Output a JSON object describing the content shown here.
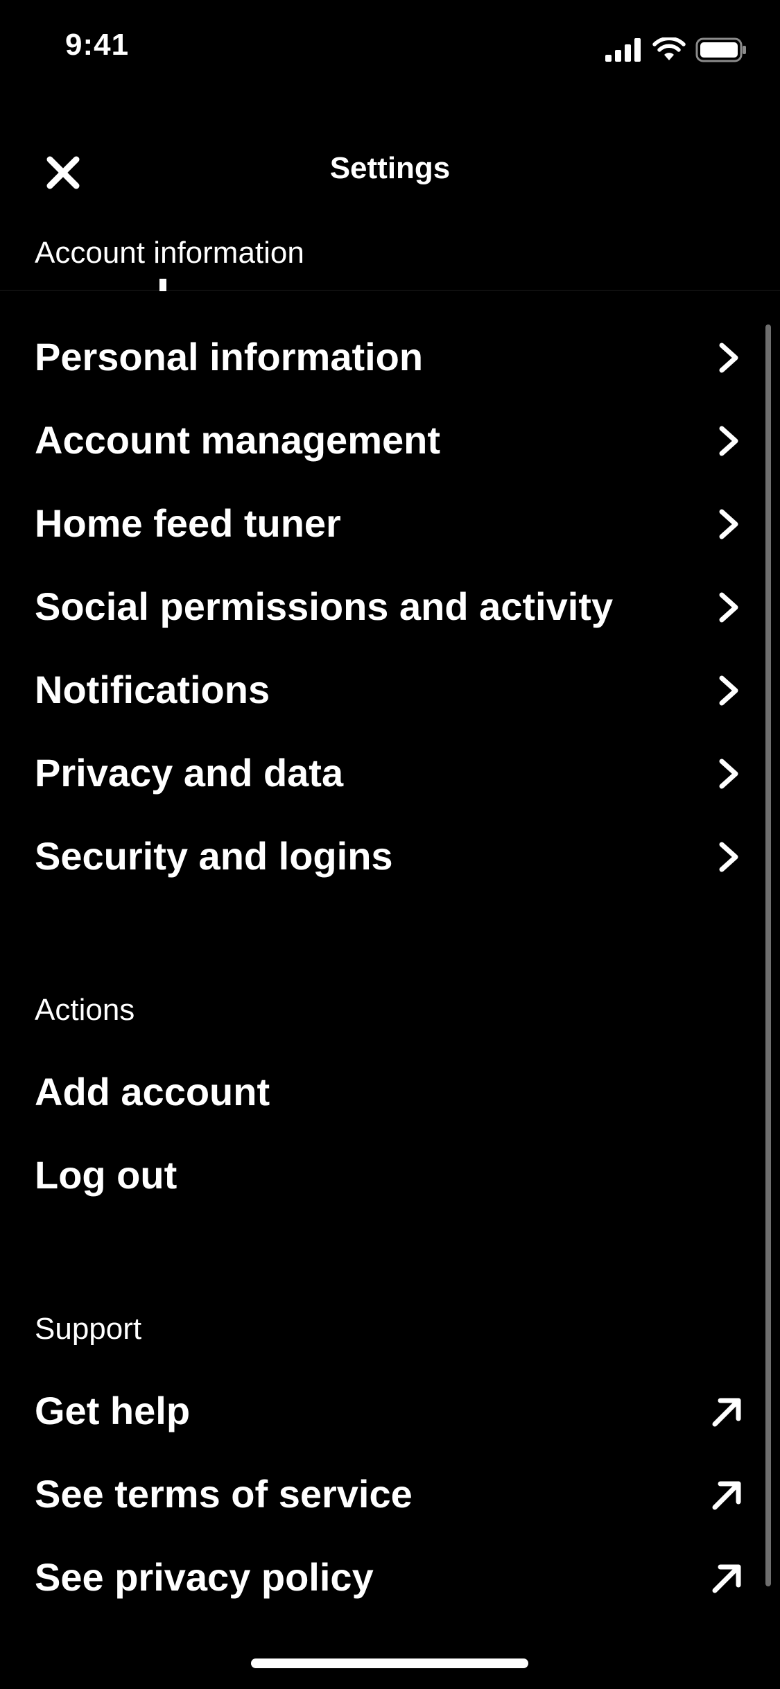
{
  "status_bar": {
    "time": "9:41",
    "icons": [
      "cellular-signal-icon",
      "wifi-icon",
      "battery-icon"
    ]
  },
  "header": {
    "title": "Settings",
    "close_icon": "close-icon"
  },
  "sections": {
    "account": {
      "heading": "Account information",
      "items": [
        {
          "label": "Personal information",
          "icon": "chevron-right-icon"
        },
        {
          "label": "Account management",
          "icon": "chevron-right-icon"
        },
        {
          "label": "Home feed tuner",
          "icon": "chevron-right-icon"
        },
        {
          "label": "Social permissions and activity",
          "icon": "chevron-right-icon"
        },
        {
          "label": "Notifications",
          "icon": "chevron-right-icon"
        },
        {
          "label": "Privacy and data",
          "icon": "chevron-right-icon"
        },
        {
          "label": "Security and logins",
          "icon": "chevron-right-icon"
        }
      ]
    },
    "actions": {
      "heading": "Actions",
      "items": [
        {
          "label": "Add account"
        },
        {
          "label": "Log out"
        }
      ]
    },
    "support": {
      "heading": "Support",
      "items": [
        {
          "label": "Get help",
          "icon": "external-link-arrow-icon"
        },
        {
          "label": "See terms of service",
          "icon": "external-link-arrow-icon"
        },
        {
          "label": "See privacy policy",
          "icon": "external-link-arrow-icon"
        }
      ]
    }
  },
  "colors": {
    "background": "#000000",
    "text": "#ffffff",
    "scrollbar": "#6e6e6e"
  }
}
